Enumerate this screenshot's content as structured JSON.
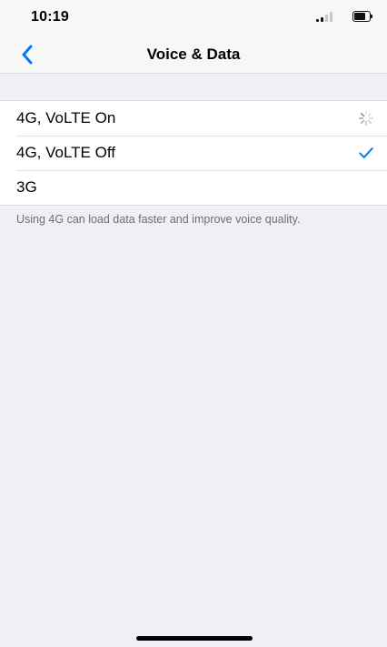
{
  "status_bar": {
    "time": "10:19",
    "signal_icon": "cellular-signal-icon",
    "battery_icon": "battery-icon"
  },
  "nav": {
    "back_icon": "chevron-left-icon",
    "title": "Voice & Data",
    "accent_color": "#007aff"
  },
  "options": [
    {
      "label": "4G, VoLTE On",
      "accessory": "loading-spinner-icon",
      "selected": false
    },
    {
      "label": "4G, VoLTE Off",
      "accessory": "checkmark-icon",
      "selected": true
    },
    {
      "label": "3G",
      "accessory": "",
      "selected": false
    }
  ],
  "footer": {
    "note": "Using 4G can load data faster and improve voice quality."
  }
}
